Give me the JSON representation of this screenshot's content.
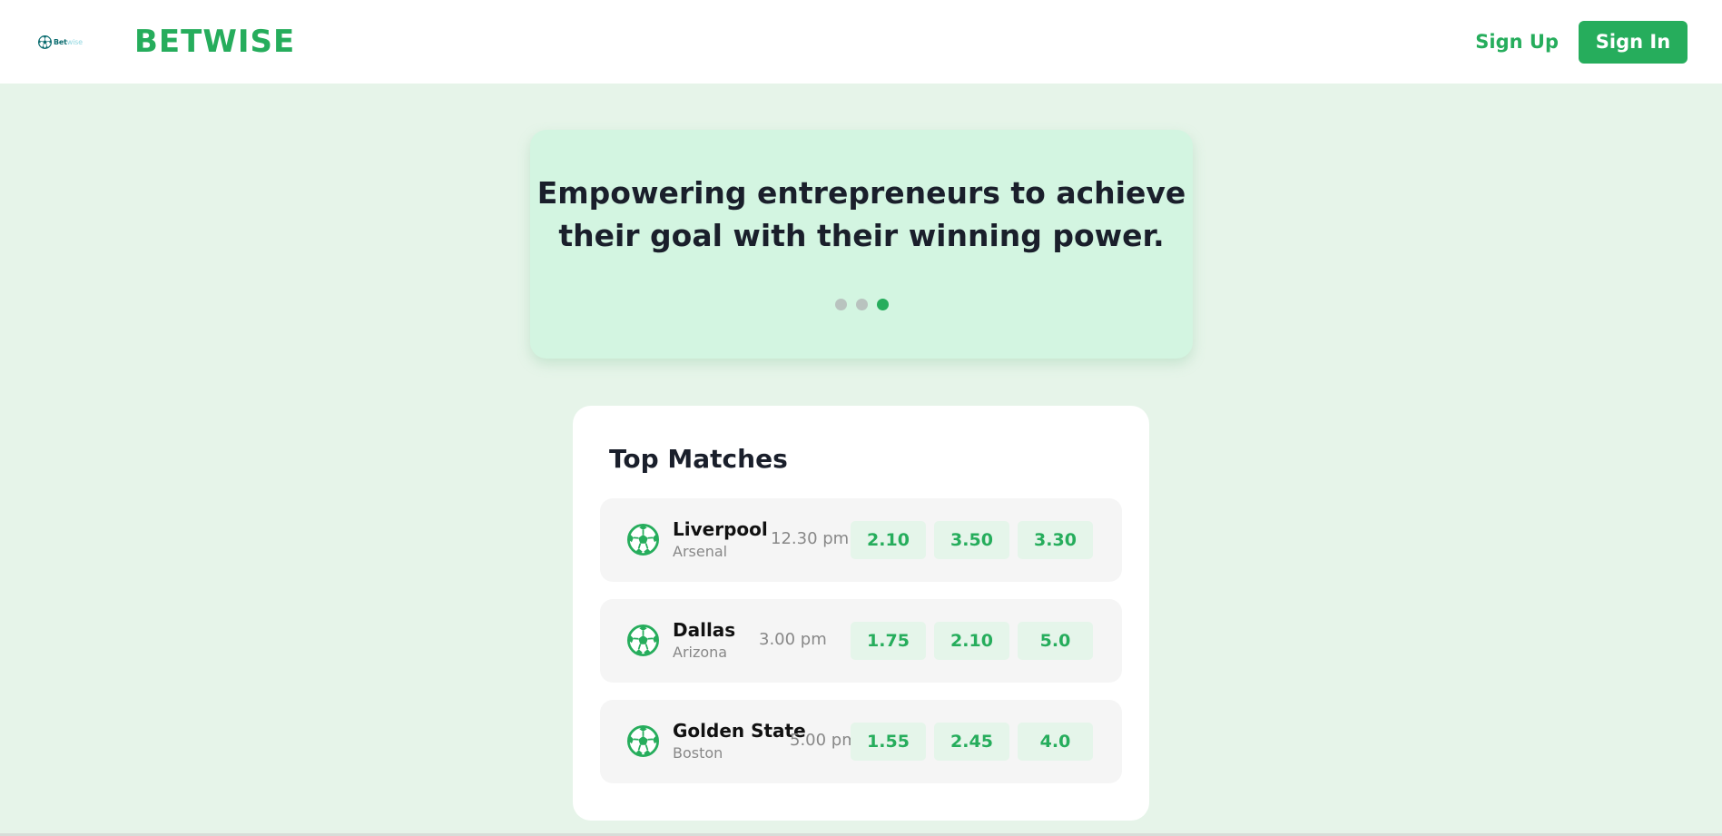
{
  "header": {
    "logo_mini_text_bold": "Bet",
    "logo_mini_text_light": "wise",
    "brand": "BETWISE",
    "signup_label": "Sign Up",
    "signin_label": "Sign In"
  },
  "hero": {
    "line1": "Empowering entrepreneurs to achieve",
    "line2": "their goal with their winning power.",
    "slides_total": 3,
    "active_slide": 3
  },
  "matches": {
    "title": "Top Matches",
    "items": [
      {
        "home": "Liverpool",
        "away": "Arsenal",
        "time": "12.30 pm",
        "odds": [
          "2.10",
          "3.50",
          "3.30"
        ]
      },
      {
        "home": "Dallas",
        "away": "Arizona",
        "time": "3.00 pm",
        "odds": [
          "1.75",
          "2.10",
          "5.0"
        ]
      },
      {
        "home": "Golden State",
        "away": "Boston",
        "time": "5.00 pm",
        "odds": [
          "1.55",
          "2.45",
          "4.0"
        ]
      }
    ]
  },
  "colors": {
    "brand_green": "#26ad5c",
    "page_background": "#e6f4e9",
    "hero_background": "#d3f5e1",
    "odd_background": "#e5f5ea"
  },
  "icons": {
    "match_icon": "soccer-ball-icon",
    "logo_icon": "soccer-ball-icon"
  }
}
